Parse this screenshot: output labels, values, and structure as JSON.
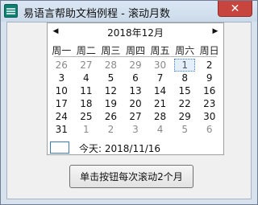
{
  "window": {
    "title": "易语言帮助文档例程 - 滚动月数",
    "close_symbol": "✕"
  },
  "calendar": {
    "prev_symbol": "◀",
    "next_symbol": "▶",
    "month_title": "2018年12月",
    "weekdays": [
      "周一",
      "周二",
      "周三",
      "周四",
      "周五",
      "周六",
      "周日"
    ],
    "weeks": [
      [
        "26",
        "27",
        "28",
        "29",
        "30",
        "1",
        "2"
      ],
      [
        "3",
        "4",
        "5",
        "6",
        "7",
        "8",
        "9"
      ],
      [
        "10",
        "11",
        "12",
        "13",
        "14",
        "15",
        "16"
      ],
      [
        "17",
        "18",
        "19",
        "20",
        "21",
        "22",
        "23"
      ],
      [
        "24",
        "25",
        "26",
        "27",
        "28",
        "29",
        "30"
      ],
      [
        "31",
        "1",
        "2",
        "3",
        "4",
        "5",
        "6"
      ]
    ],
    "today_text": "今天: 2018/11/16"
  },
  "button": {
    "label": "单击按钮每次滚动2个月"
  }
}
